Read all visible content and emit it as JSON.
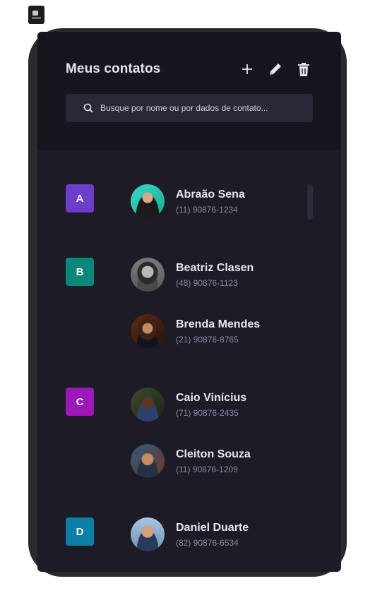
{
  "header": {
    "title": "Meus contatos",
    "search_placeholder": "Busque por nome ou por dados de contato..."
  },
  "actions": [
    {
      "icon": "plus-icon"
    },
    {
      "icon": "pencil-icon"
    },
    {
      "icon": "trash-icon"
    }
  ],
  "groups": [
    {
      "letter": "A",
      "color": "#6c3ec9",
      "contacts": [
        {
          "name": "Abraão Sena",
          "phone": "(11) 90876-1234"
        }
      ]
    },
    {
      "letter": "B",
      "color": "#0c857a",
      "contacts": [
        {
          "name": "Beatriz Clasen",
          "phone": "(48) 90876-1123"
        },
        {
          "name": "Brenda Mendes",
          "phone": "(21) 90876-8765"
        }
      ]
    },
    {
      "letter": "C",
      "color": "#9d18b8",
      "contacts": [
        {
          "name": "Caio Vinícius",
          "phone": "(71) 90876-2435"
        },
        {
          "name": "Cleiton Souza",
          "phone": "(11) 90876-1209"
        }
      ]
    },
    {
      "letter": "D",
      "color": "#0c7fa6",
      "contacts": [
        {
          "name": "Daniel Duarte",
          "phone": "(82) 90876-6534"
        }
      ]
    }
  ]
}
